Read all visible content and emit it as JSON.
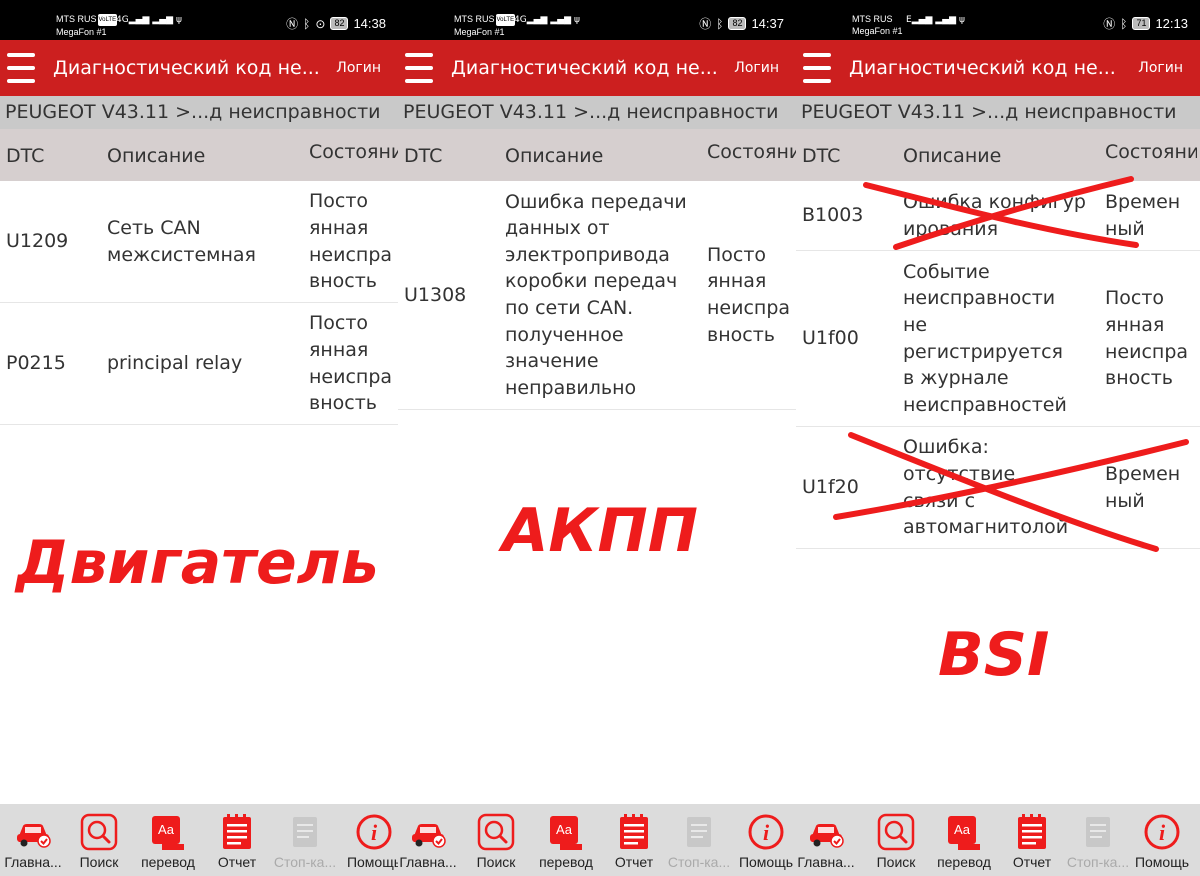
{
  "colors": {
    "accent": "#cc1f1f",
    "overlay_red": "#ee1c1c",
    "breadcrumb_bg": "#c9c9c9",
    "header_bg": "#d6cfcf",
    "nav_bg": "#dcdcdc"
  },
  "panels": [
    {
      "status": {
        "carrier1": "MTS RUS",
        "volte": "VoLTE",
        "carrier2": "MegaFon #1",
        "network": "4G",
        "battery": "82",
        "time": "14:38"
      },
      "toolbar": {
        "title": "Диагностический код не...",
        "login": "Логин"
      },
      "breadcrumb": "PEUGEOT V43.11 >...д неисправности",
      "columns": {
        "dtc": "DTC",
        "desc": "Описание",
        "state": "Состояние"
      },
      "rows": [
        {
          "dtc": "U1209",
          "desc": "Сеть CAN\nмежсистемная",
          "state": "Посто\nянная\nнеиспра\nвность"
        },
        {
          "dtc": "P0215",
          "desc": "principal relay",
          "state": "Посто\nянная\nнеиспра\nвность"
        }
      ],
      "overlay": "Двигатель",
      "nav": [
        "Главна...",
        "Поиск",
        "перевод",
        "Отчет",
        "Стоп-ка...",
        "Помощь"
      ]
    },
    {
      "status": {
        "carrier1": "MTS RUS",
        "volte": "VoLTE",
        "carrier2": "MegaFon #1",
        "network": "4G",
        "battery": "82",
        "time": "14:37"
      },
      "toolbar": {
        "title": "Диагностический код не...",
        "login": "Логин"
      },
      "breadcrumb": "PEUGEOT V43.11 >...д неисправности",
      "columns": {
        "dtc": "DTC",
        "desc": "Описание",
        "state": "Состояние"
      },
      "rows": [
        {
          "dtc": "U1308",
          "desc": "Ошибка передачи\nданных от\nэлектропривода\nкоробки передач\nпо сети CAN.\nполученное\nзначение\nнеправильно",
          "state": "Посто\nянная\nнеиспра\nвность"
        }
      ],
      "overlay": "АКПП",
      "nav": [
        "Главна...",
        "Поиск",
        "перевод",
        "Отчет",
        "Стоп-ка...",
        "Помощь"
      ]
    },
    {
      "status": {
        "carrier1": "MTS RUS",
        "volte": "",
        "carrier2": "MegaFon #1",
        "network": "E",
        "battery": "71",
        "time": "12:13"
      },
      "toolbar": {
        "title": "Диагностический код не...",
        "login": "Логин"
      },
      "breadcrumb": "PEUGEOT V43.11 >...д неисправности",
      "columns": {
        "dtc": "DTC",
        "desc": "Описание",
        "state": "Состояние"
      },
      "rows": [
        {
          "dtc": "B1003",
          "desc": "Ошибка конфигур\nирования",
          "state": "Времен\nный",
          "crossed": true
        },
        {
          "dtc": "U1f00",
          "desc": "Событие\nнеисправности\nне\nрегистрируется\nв журнале\nнеисправностей",
          "state": "Посто\nянная\nнеиспра\nвность",
          "crossed": false
        },
        {
          "dtc": "U1f20",
          "desc": "Ошибка:\nотсутствие\nсвязи с\nавтомагнитолой",
          "state": "Времен\nный",
          "crossed": true
        }
      ],
      "overlay": "BSI",
      "nav": [
        "Главна...",
        "Поиск",
        "перевод",
        "Отчет",
        "Стоп-ка...",
        "Помощь"
      ]
    }
  ]
}
